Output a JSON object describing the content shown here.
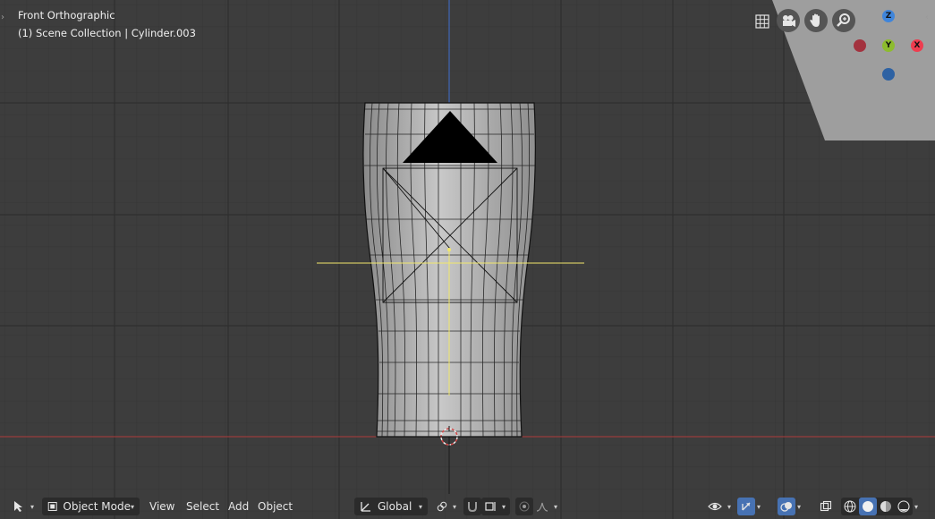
{
  "viewport": {
    "view_name": "Front Orthographic",
    "collection_info": "(1) Scene Collection | Cylinder.003"
  },
  "navigation": {
    "buttons": [
      "grid-icon",
      "camera-icon",
      "hand-icon",
      "zoom-icon"
    ]
  },
  "gizmo": {
    "z_label": "Z",
    "y_label": "Y",
    "x_label": "X",
    "colors": {
      "x": "#ee3d4f",
      "y": "#8dbc2e",
      "z": "#3f85db",
      "neg_x": "#a3323e",
      "neg_z": "#2e62a3"
    }
  },
  "header": {
    "mode_label": "Object Mode",
    "menus": {
      "view": "View",
      "select": "Select",
      "add": "Add",
      "object": "Object"
    },
    "orientation_label": "Global"
  },
  "colors": {
    "background": "#3d3d3d",
    "grid_line": "#353535",
    "grid_major": "#2a2a2a",
    "x_axis": "#c24848",
    "z_axis": "#3f6ed0",
    "selected": "#f2e86b",
    "accent": "#4772b3"
  }
}
